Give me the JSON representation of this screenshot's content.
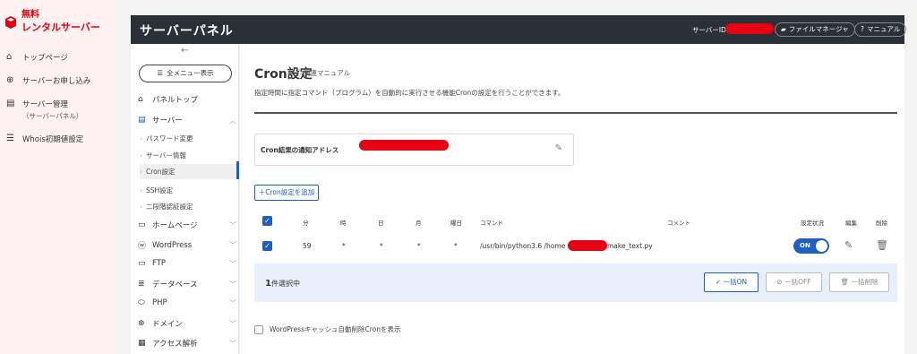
{
  "brand": {
    "line1": "無料",
    "line2": "レンタルサーバー"
  },
  "left_nav": [
    {
      "icon": "home-icon",
      "label": "トップページ"
    },
    {
      "icon": "plus-circle-icon",
      "label": "サーバーお申し込み"
    },
    {
      "icon": "server-icon",
      "label": "サーバー管理",
      "sub": "（サーバーパネル）"
    },
    {
      "icon": "list-icon",
      "label": "Whois初期値設定"
    }
  ],
  "topbar": {
    "title": "サーバーパネル",
    "server_id_label": "サーバーID",
    "file_manager": "ファイルマネージャ",
    "manual": "マニュアル"
  },
  "panel_nav": {
    "all_menu": "全メニュー表示",
    "panel_top": "パネルトップ",
    "server": "サーバー",
    "subs": [
      "パスワード変更",
      "サーバー情報",
      "Cron設定",
      "SSH設定",
      "二段階認証設定"
    ],
    "homepage": "ホームページ",
    "wordpress": "WordPress",
    "ftp": "FTP",
    "database": "データベース",
    "php": "PHP",
    "domain": "ドメイン",
    "analytics": "アクセス解析"
  },
  "main": {
    "title": "Cron設定",
    "manual_link": "関連マニュアル",
    "description": "指定時間に指定コマンド（プログラム）を自動的に実行させる機能Cronの設定を行うことができます。",
    "notify_label": "Cron結果の通知アドレス",
    "add_button": "＋Cron設定を追加",
    "columns": {
      "min": "分",
      "hour": "時",
      "day": "日",
      "month": "月",
      "weekday": "曜日",
      "command": "コマンド",
      "comment": "コメント",
      "status": "設定状況",
      "edit": "編集",
      "delete": "削除"
    },
    "row": {
      "min": "59",
      "hour": "*",
      "day": "*",
      "month": "*",
      "weekday": "*",
      "cmd_prefix": "/usr/bin/python3.6 /home",
      "cmd_suffix": "make_text.py",
      "status": "ON"
    },
    "selected_count": "1",
    "selected_text": "件選択中",
    "bulk_on": "一括ON",
    "bulk_off": "一括OFF",
    "bulk_delete": "一括削除",
    "wp_cache_label": "WordPressキャッシュ自動削除Cronを表示"
  },
  "colors": {
    "accent": "#1f5fbf",
    "brand_red": "#e60012",
    "topbar": "#2b2f38"
  }
}
